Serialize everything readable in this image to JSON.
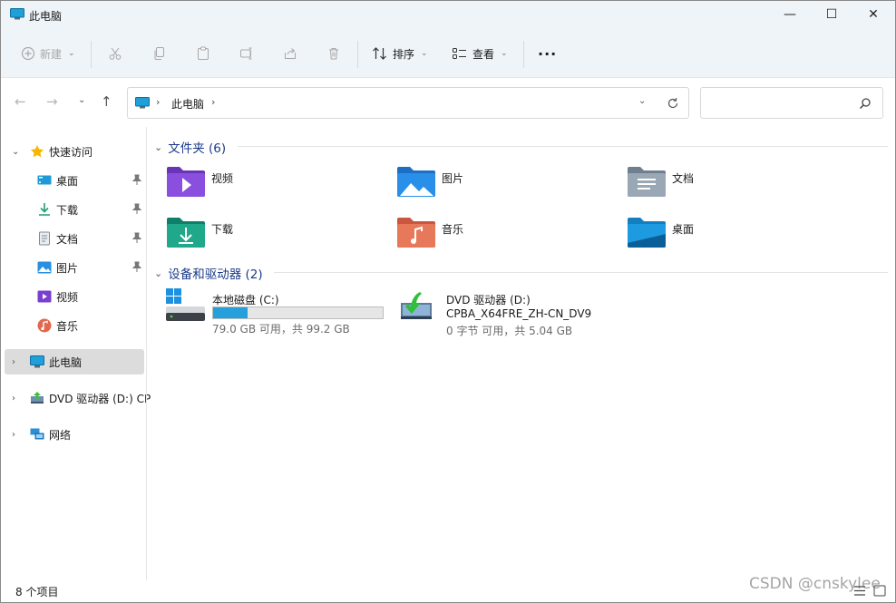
{
  "window": {
    "title": "此电脑",
    "controls": {
      "minimize": "—",
      "maximize": "☐",
      "close": "✕"
    }
  },
  "toolbar": {
    "new_label": "新建",
    "sort_label": "排序",
    "view_label": "查看",
    "more_label": "···"
  },
  "address": {
    "crumb": "此电脑",
    "search_placeholder": ""
  },
  "sidebar": {
    "quick_access": "快速访问",
    "items": [
      {
        "label": "桌面",
        "icon": "desktop-icon",
        "pinned": true
      },
      {
        "label": "下载",
        "icon": "download-icon",
        "pinned": true
      },
      {
        "label": "文档",
        "icon": "document-icon",
        "pinned": true
      },
      {
        "label": "图片",
        "icon": "picture-icon",
        "pinned": true
      },
      {
        "label": "视频",
        "icon": "video-icon",
        "pinned": false
      },
      {
        "label": "音乐",
        "icon": "music-icon",
        "pinned": false
      }
    ],
    "this_pc": "此电脑",
    "dvd": "DVD 驱动器 (D:) CP",
    "network": "网络"
  },
  "content": {
    "folders_header": "文件夹 (6)",
    "folders": [
      {
        "label": "视频",
        "icon": "video-folder-icon"
      },
      {
        "label": "图片",
        "icon": "picture-folder-icon"
      },
      {
        "label": "文档",
        "icon": "document-folder-icon"
      },
      {
        "label": "下载",
        "icon": "download-folder-icon"
      },
      {
        "label": "音乐",
        "icon": "music-folder-icon"
      },
      {
        "label": "桌面",
        "icon": "desktop-folder-icon"
      }
    ],
    "devices_header": "设备和驱动器 (2)",
    "drives": [
      {
        "name": "本地磁盘 (C:)",
        "free": "79.0 GB 可用，共 99.2 GB",
        "used_fraction": 0.2036
      },
      {
        "name": "DVD 驱动器 (D:)",
        "volume": "CPBA_X64FRE_ZH-CN_DV9",
        "free": "0 字节 可用，共 5.04 GB"
      }
    ]
  },
  "status": {
    "item_count": "8 个项目"
  },
  "watermark": "CSDN @cnskylee",
  "colors": {
    "accent": "#26a0da",
    "header_blue": "#1b3b8a",
    "chrome_bg": "#eff4f9"
  }
}
